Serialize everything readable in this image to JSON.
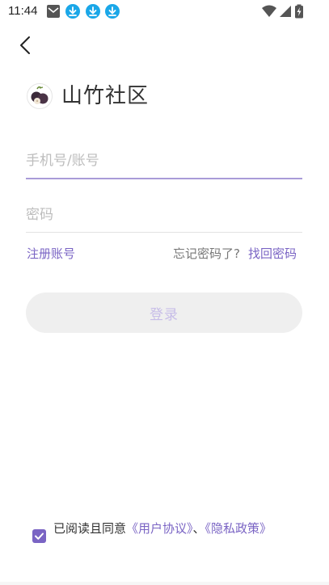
{
  "status_bar": {
    "time": "11:44",
    "icons": [
      "mail-icon",
      "download-icon",
      "download-icon",
      "download-icon",
      "wifi-icon",
      "signal-icon",
      "battery-charging-icon"
    ]
  },
  "app": {
    "title": "山竹社区",
    "logo_icon": "mangosteen-logo"
  },
  "form": {
    "account_placeholder": "手机号/账号",
    "account_value": "",
    "password_placeholder": "密码",
    "password_value": ""
  },
  "links": {
    "register": "注册账号",
    "forgot_prompt": "忘记密码了?",
    "recover": "找回密码"
  },
  "login_button": "登录",
  "agreement": {
    "checked": true,
    "prefix": "已阅读且同意",
    "user_agreement": "《用户协议》",
    "separator": "、",
    "privacy_policy": "《隐私政策》"
  },
  "colors": {
    "accent": "#7a64c4",
    "input_active_underline": "#a99bd8",
    "button_bg": "#efefef",
    "download_badge": "#1aa7e8"
  }
}
